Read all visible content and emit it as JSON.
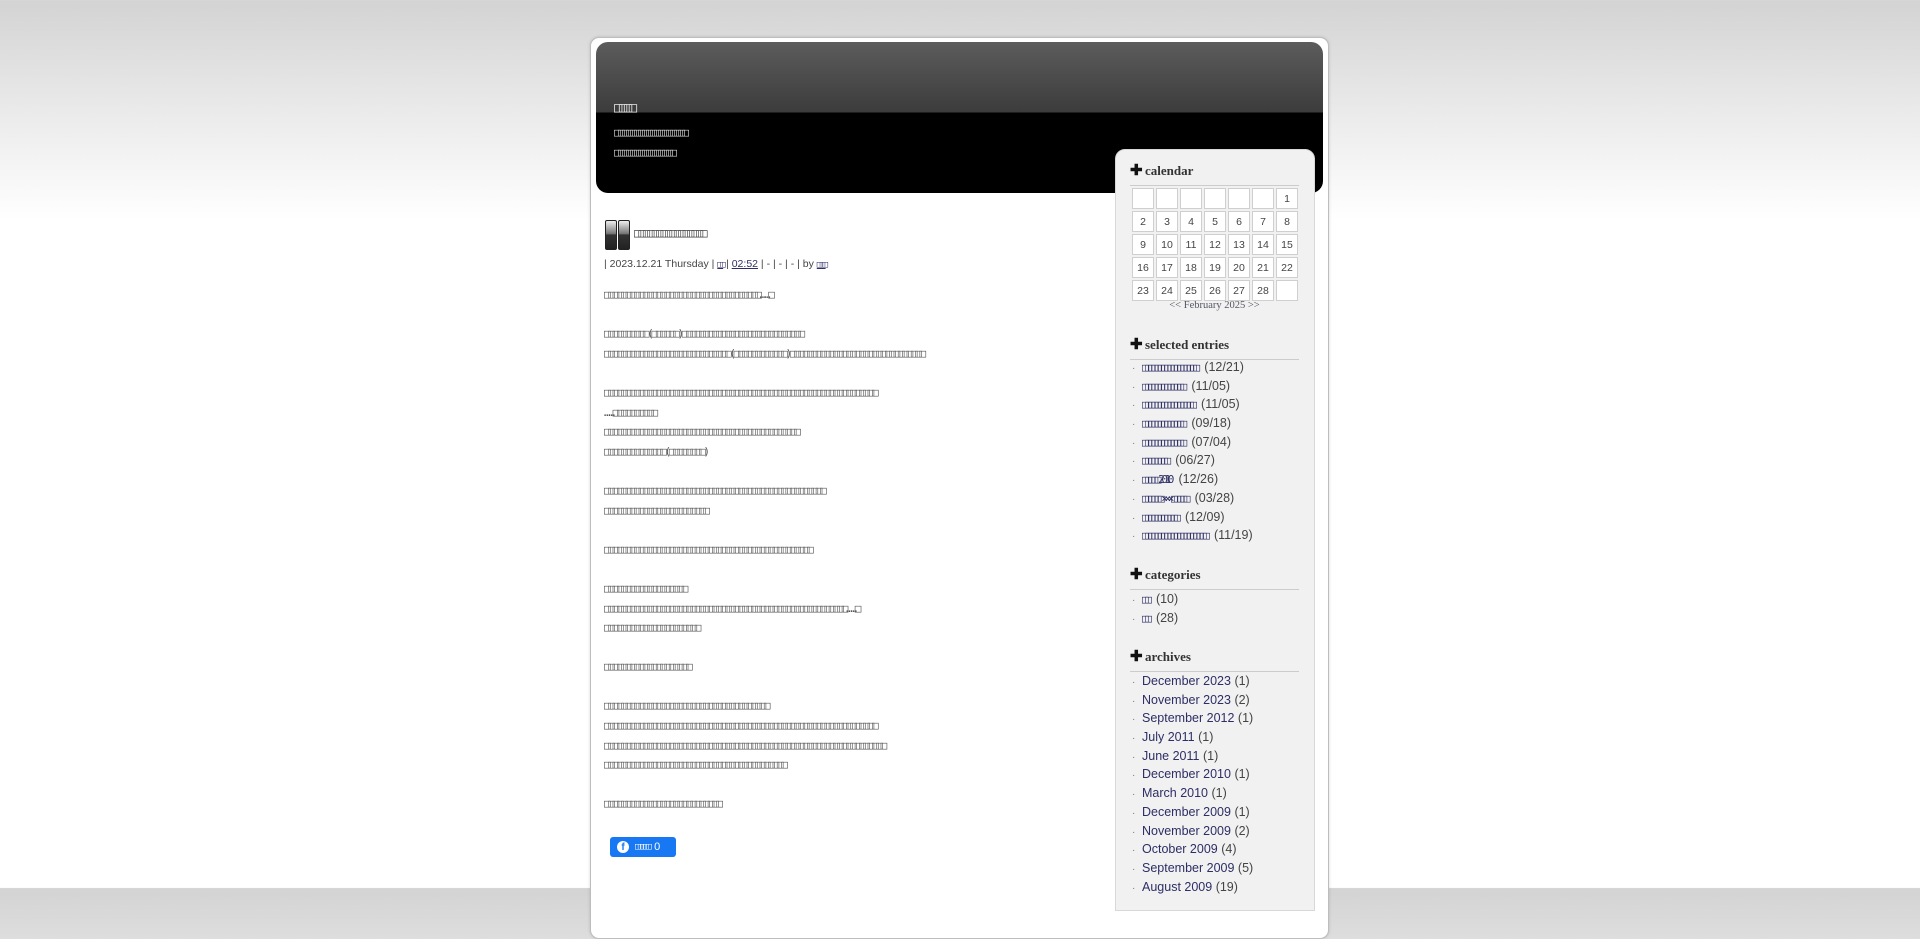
{
  "header": {
    "title": "□□□□",
    "tagline": [
      "□□□□□□□□□□□□□□□□□□",
      "□□□□□□□□□□□□□□□"
    ]
  },
  "post": {
    "title": "□□□□□□□□□□□□□□□□",
    "date": "2023.12.21 Thursday",
    "category": "□□",
    "time": "02:52",
    "dashes": "- | - | -",
    "by": "by",
    "author": "□□□",
    "body": [
      "□□□□□□□□□□□□□□□□□□□□□□□□□□□□□□□□□□□□……□",
      "",
      "□□□□□□□□□□(□□□□□□)□□□□□□□□□□□□□□□□□□□□□□□□□□□□",
      "□□□□□□□□□□□□□□□□□□□□□□□□□□□□□(□□□□□□□□□□□□)□□□□□□□□□□□□□□□□□□□□□□□□□□□□□□□",
      "",
      "□□□□□□□□□□□□□□□□□□□□□□□□□□□□□□□□□□□□□□□□□□□□□□□□□□□□□□□□□□□□□□□",
      "……□□□□□□□□□□",
      "□□□□□□□□□□□□□□□□□□□□□□□□□□□□□□□□□□□□□□□□□□□□□",
      "□□□□□□□□□□□□□□(□□□□□□□□)",
      "",
      "□□□□□□□□□□□□□□□□□□□□□□□□□□□□□□□□□□□□□□□□□□□□□□□□□□□",
      "□□□□□□□□□□□□□□□□□□□□□□□□",
      "",
      "□□□□□□□□□□□□□□□□□□□□□□□□□□□□□□□□□□□□□□□□□□□□□□□□",
      "",
      "□□□□□□□□□□□□□□□□□□□",
      "□□□□□□□□□□□□□□□□□□□□□□□□□□□□□□□□□□□□□□□□□□□□□□□□□□□□□□□□……□",
      "□□□□□□□□□□□□□□□□□□□□□□",
      "",
      "□□□□□□□□□□□□□□□□□□□□",
      "",
      "□□□□□□□□□□□□□□□□□□□□□□□□□□□□□□□□□□□□□□",
      "□□□□□□□□□□□□□□□□□□□□□□□□□□□□□□□□□□□□□□□□□□□□□□□□□□□□□□□□□□□□□□□",
      "□□□□□□□□□□□□□□□□□□□□□□□□□□□□□□□□□□□□□□□□□□□□□□□□□□□□□□□□□□□□□□□□□",
      "□□□□□□□□□□□□□□□□□□□□□□□□□□□□□□□□□□□□□□□□□□",
      "",
      "□□□□□□□□□□□□□□□□□□□□□□□□□□□"
    ],
    "fb_label": "□□□□□",
    "fb_count": "0"
  },
  "sidebar": {
    "calendar": {
      "title": "calendar",
      "weeks": [
        [
          "",
          "",
          "",
          "",
          "",
          "",
          "1"
        ],
        [
          "2",
          "3",
          "4",
          "5",
          "6",
          "7",
          "8"
        ],
        [
          "9",
          "10",
          "11",
          "12",
          "13",
          "14",
          "15"
        ],
        [
          "16",
          "17",
          "18",
          "19",
          "20",
          "21",
          "22"
        ],
        [
          "23",
          "24",
          "25",
          "26",
          "27",
          "28",
          ""
        ]
      ],
      "prev": "<<",
      "month": "February 2025",
      "next": ">>"
    },
    "selected_entries": {
      "title": "selected entries",
      "items": [
        {
          "label": "□□□□□□□□□□□□□□□□□",
          "date": "(12/21)"
        },
        {
          "label": "□□□□□□□□□□□□□",
          "date": "(11/05)"
        },
        {
          "label": "□□□□□□□□□□□□□□□□",
          "date": "(11/05)"
        },
        {
          "label": "□□□□□□□□□□□□□",
          "date": "(09/18)"
        },
        {
          "label": "□□□□□□□□□□□□□",
          "date": "(07/04)"
        },
        {
          "label": "□□□□□□□□",
          "date": "(06/27)"
        },
        {
          "label": "□□□□□2010",
          "date": "(12/26)"
        },
        {
          "label": "□□□□□□×××□□□□□",
          "date": "(03/28)"
        },
        {
          "label": "□□□□□□□□□□□",
          "date": "(12/09)"
        },
        {
          "label": "□□□□□□□□□□□□□□□□□□□□",
          "date": "(11/19)"
        }
      ]
    },
    "categories": {
      "title": "categories",
      "items": [
        {
          "label": "□□",
          "count": "(10)"
        },
        {
          "label": "□□",
          "count": "(28)"
        }
      ]
    },
    "archives": {
      "title": "archives",
      "items": [
        {
          "label": "December 2023",
          "count": "(1)"
        },
        {
          "label": "November 2023",
          "count": "(2)"
        },
        {
          "label": "September 2012",
          "count": "(1)"
        },
        {
          "label": "July 2011",
          "count": "(1)"
        },
        {
          "label": "June 2011",
          "count": "(1)"
        },
        {
          "label": "December 2010",
          "count": "(1)"
        },
        {
          "label": "March 2010",
          "count": "(1)"
        },
        {
          "label": "December 2009",
          "count": "(1)"
        },
        {
          "label": "November 2009",
          "count": "(2)"
        },
        {
          "label": "October 2009",
          "count": "(4)"
        },
        {
          "label": "September 2009",
          "count": "(5)"
        },
        {
          "label": "August 2009",
          "count": "(19)"
        }
      ]
    }
  },
  "colors": {
    "link": "#2e2e66",
    "facebook": "#1877f2",
    "header": "#000000",
    "sidebar_bg": "#f0f1f0"
  }
}
